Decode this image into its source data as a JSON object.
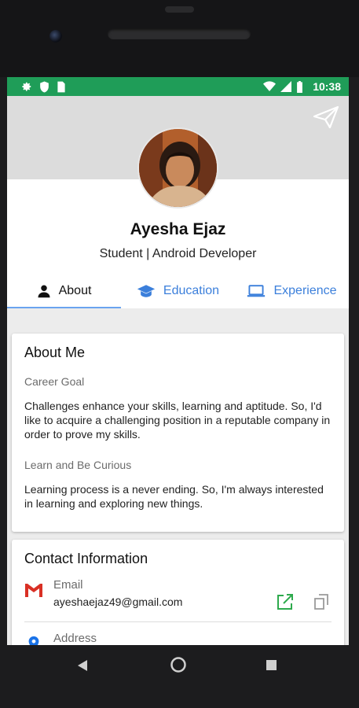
{
  "status_bar": {
    "time": "10:38",
    "left_icons": [
      "gear-icon",
      "shield-icon",
      "sim-card-icon"
    ],
    "right_icons": [
      "wifi-icon",
      "signal-icon",
      "battery-icon"
    ],
    "color": "#1f9d58"
  },
  "profile": {
    "name": "Ayesha Ejaz",
    "role": "Student | Android Developer"
  },
  "tabs": [
    {
      "label": "About",
      "icon": "person-icon",
      "active": true
    },
    {
      "label": "Education",
      "icon": "graduation-cap-icon",
      "active": false
    },
    {
      "label": "Experience",
      "icon": "laptop-icon",
      "active": false
    }
  ],
  "about": {
    "title": "About Me",
    "career_goal_label": "Career Goal",
    "career_goal_text": "Challenges enhance your skills, learning and aptitude. So, I'd like to acquire a challenging position in a reputable company in order to prove my skills.",
    "curious_label": "Learn and Be Curious",
    "curious_text": "Learning process is a never ending. So, I'm always interested in learning and exploring new things."
  },
  "contact": {
    "title": "Contact Information",
    "email_label": "Email",
    "email_value": "ayeshaejaz49@gmail.com",
    "address_label": "Address"
  },
  "colors": {
    "accent": "#3b7fdb",
    "tab_indicator": "#6aa3ef",
    "open_icon": "#2eaa4d"
  }
}
